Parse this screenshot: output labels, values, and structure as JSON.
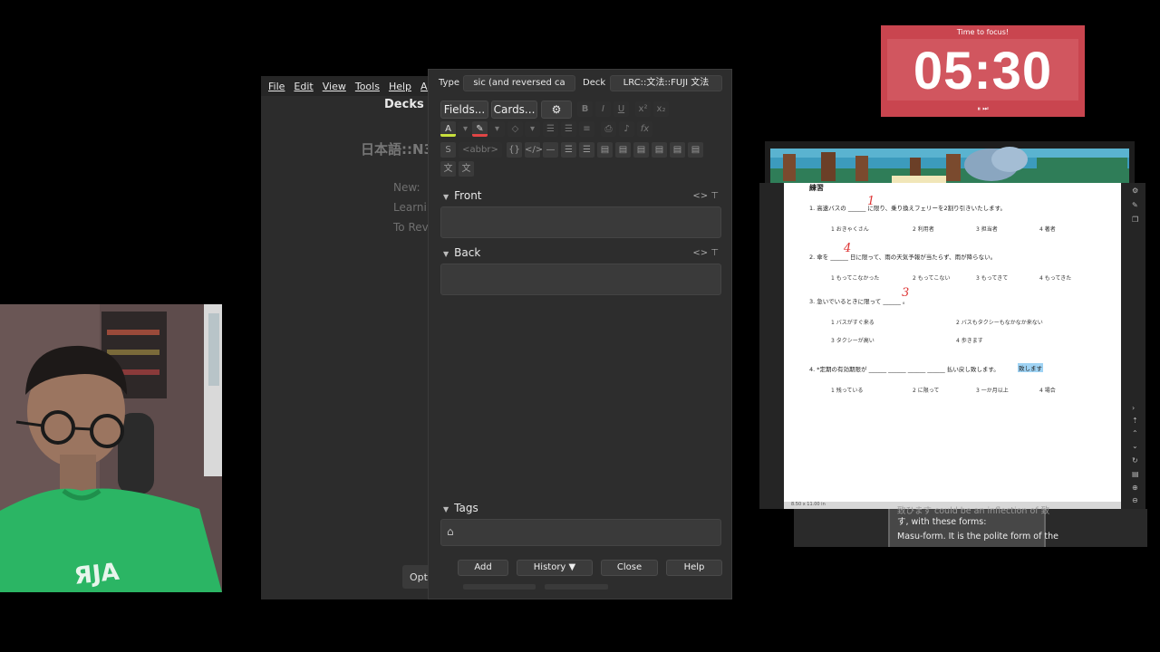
{
  "anki_main": {
    "menu": [
      "File",
      "Edit",
      "View",
      "Tools",
      "Help",
      "Anki"
    ],
    "header": "Decks",
    "deck_title": "日本語::N3:",
    "stats": [
      "New:",
      "Learnir",
      "To Revi"
    ],
    "options_button": "Opti"
  },
  "add_dialog": {
    "type_label": "Type",
    "type_value": "sic (and reversed ca",
    "deck_label": "Deck",
    "deck_value": "LRC::文法::FUJI 文法",
    "fields_button": "Fields...",
    "cards_button": "Cards...",
    "gear_icon": "⚙",
    "abbr_tag": "<abbr>",
    "front_label": "Front",
    "back_label": "Back",
    "tags_label": "Tags",
    "field_tools": "<>  ⊤",
    "bottom_buttons": {
      "add": "Add",
      "history": "History ▼",
      "close": "Close",
      "help": "Help"
    }
  },
  "timer": {
    "label": "Time to focus!",
    "value": "05:30",
    "controls": "⏸ ⏭"
  },
  "pdf": {
    "title": "練習",
    "questions": [
      "1. 高速バスの ______ に限り、乗り換えフェリーを2割り引きいたします。",
      "2. 傘を ______ 日に限って、雨の天気予報が当たらず、雨が降らない。",
      "3. 急いでいるときに限って ______ 。",
      "4. *定期の有効期限が ______ ______ ______ ______ 払い戻し致します。"
    ],
    "options": [
      [
        "1 おきゃくさん",
        "2 利用者",
        "3 担当者",
        "4 著者"
      ],
      [
        "1 もってこなかった",
        "2 もってこない",
        "3 もってきて",
        "4 もってきた"
      ],
      [
        "1 バスがすぐ来る",
        "2 バスもタクシーもなかなか来ない"
      ],
      [
        "3 タクシーが高い",
        "4 歩きます"
      ],
      [
        "1 残っている",
        "2 に限って",
        "3 一か月以上",
        "4 場合"
      ]
    ],
    "answers": [
      "1",
      "4",
      "3"
    ],
    "highlight": "致します",
    "footer": "8.50 x 11.00 in"
  },
  "definition": {
    "line1": "致ひます could be an inflection of 致",
    "line2": "す, with these forms:",
    "line3": "Masu-form. It is the polite form of the"
  }
}
